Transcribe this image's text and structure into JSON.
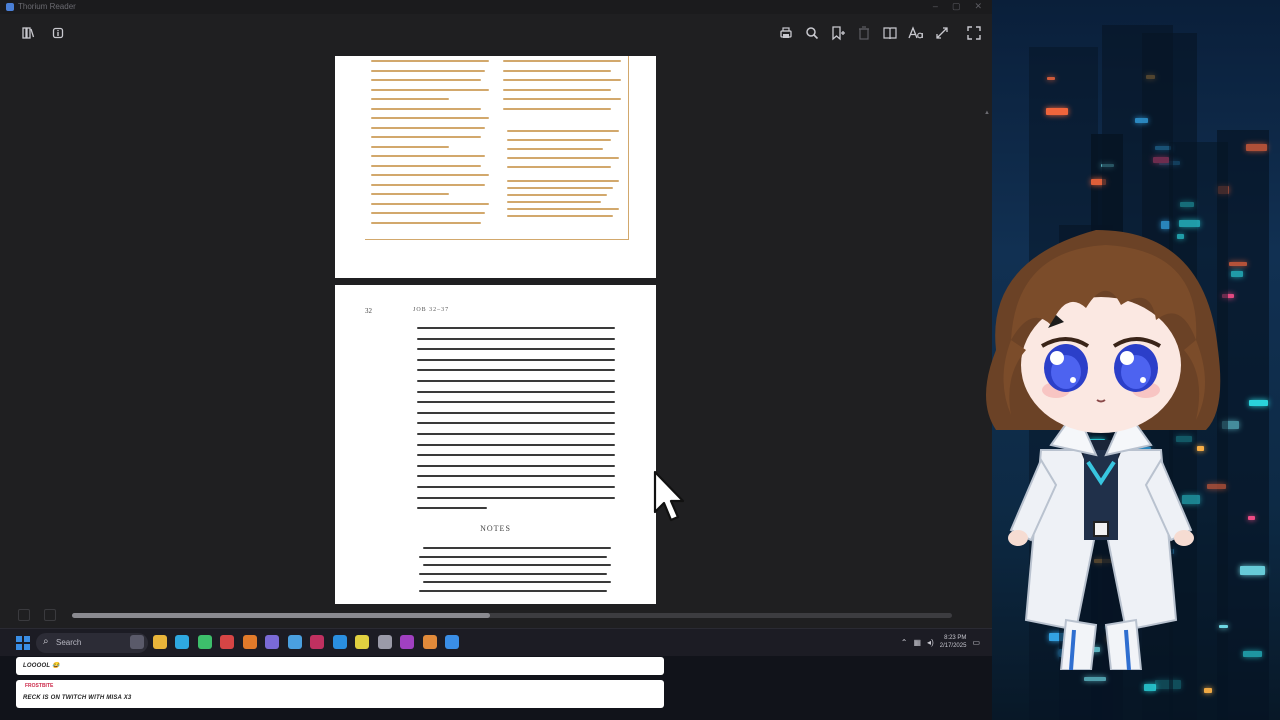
{
  "window": {
    "title": "Thorium Reader"
  },
  "toolbar": {
    "left_icons": [
      "library-icon",
      "info-icon"
    ],
    "right_icons": [
      "print-icon",
      "search-icon",
      "bookmark-add-icon",
      "delete-icon",
      "toc-icon",
      "text-settings-icon",
      "fullscreen-small-icon",
      "fullscreen-icon"
    ]
  },
  "book": {
    "page_number": "32",
    "running_head": "JOB 32–37",
    "notes_heading": "NOTES"
  },
  "reading_progress": 0.475,
  "taskbar": {
    "search_placeholder": "Search",
    "tray_time": "8:23 PM",
    "tray_date": "2/17/2025"
  },
  "chat": [
    {
      "user": "",
      "message": "LOOOOL 😂"
    },
    {
      "user": "FROSTBITE",
      "message": "RECK IS ON TWITCH WITH MISA X3"
    }
  ],
  "colors": {
    "reader_bg": "#1f1f21",
    "page_bg": "#ffffff",
    "highlight": "#d2a86c",
    "progress_fill": "#8a8a90",
    "taskbar_bg": "#1c1c24",
    "accent_blue": "#3a8ee6"
  }
}
